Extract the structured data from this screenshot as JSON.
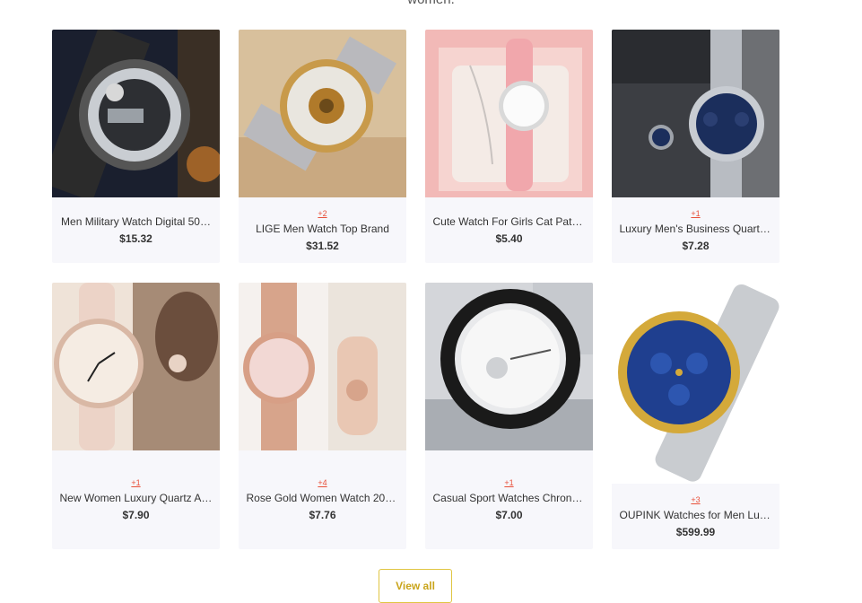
{
  "section": {
    "top_text": "women."
  },
  "products": [
    {
      "badge": "",
      "title": "Men Military Watch Digital 50…",
      "price": "$15.32"
    },
    {
      "badge": "+2",
      "title": "LIGE Men Watch Top Brand",
      "price": "$31.52"
    },
    {
      "badge": "",
      "title": "Cute Watch For Girls Cat Patt…",
      "price": "$5.40"
    },
    {
      "badge": "+1",
      "title": "Luxury Men's Business Quartz…",
      "price": "$7.28"
    },
    {
      "badge": "+1",
      "title": "New Women Luxury Quartz Al…",
      "price": "$7.90"
    },
    {
      "badge": "+4",
      "title": "Rose Gold Women Watch 202…",
      "price": "$7.76"
    },
    {
      "badge": "+1",
      "title": "Casual Sport Watches Chrono…",
      "price": "$7.00"
    },
    {
      "badge": "+3",
      "title": "OUPINK Watches for Men Lux…",
      "price": "$599.99"
    }
  ],
  "view_all": {
    "label": "View all"
  },
  "colors": {
    "badge": "#e8503a",
    "accent": "#c9a41a",
    "card_bg": "#f7f7fb"
  }
}
